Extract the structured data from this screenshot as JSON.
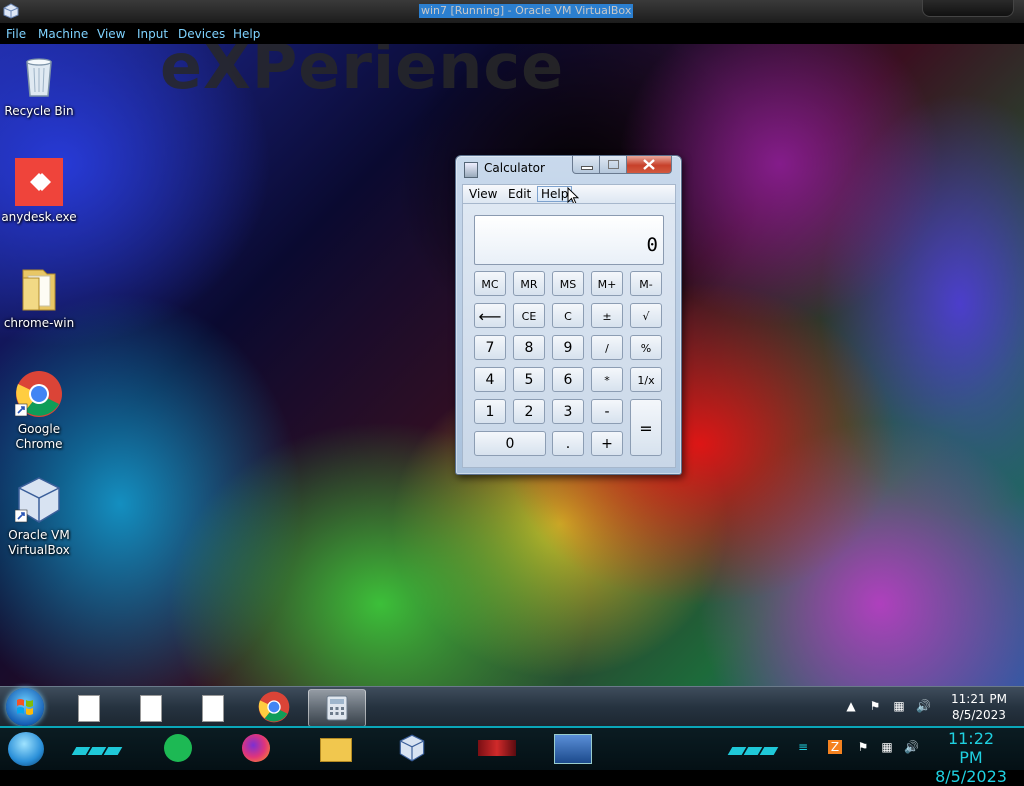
{
  "host_window": {
    "title": "win7 [Running] - Oracle VM VirtualBox",
    "menu": [
      "File",
      "Machine",
      "View",
      "Input",
      "Devices",
      "Help"
    ]
  },
  "desktop": {
    "watermark": "eXPerience",
    "icons": [
      {
        "label": "Recycle Bin",
        "icon": "recycle-bin-icon"
      },
      {
        "label": "anydesk.exe",
        "icon": "anydesk-icon",
        "color": "#ef443b"
      },
      {
        "label": "chrome-win",
        "icon": "folder-icon"
      },
      {
        "label": "Google Chrome",
        "icon": "chrome-icon"
      },
      {
        "label": "Oracle VM VirtualBox",
        "icon": "virtualbox-icon"
      }
    ]
  },
  "calculator": {
    "title": "Calculator",
    "menu": [
      "View",
      "Edit",
      "Help"
    ],
    "display": "0",
    "keys": {
      "mc": "MC",
      "mr": "MR",
      "ms": "MS",
      "mplus": "M+",
      "mminus": "M-",
      "backspace": "⟵",
      "ce": "CE",
      "c": "C",
      "plusminus": "±",
      "sqrt": "√",
      "k7": "7",
      "k8": "8",
      "k9": "9",
      "divide": "/",
      "percent": "%",
      "k4": "4",
      "k5": "5",
      "k6": "6",
      "multiply": "*",
      "reciprocal": "1/x",
      "k1": "1",
      "k2": "2",
      "k3": "3",
      "minus": "-",
      "equals": "=",
      "k0": "0",
      "decimal": ".",
      "plus": "+"
    }
  },
  "guest_taskbar": {
    "clock_time": "11:21 PM",
    "clock_date": "8/5/2023"
  },
  "host_taskbar": {
    "clock_time": "11:22 PM",
    "clock_date": "8/5/2023",
    "accent": "#1fc8d8"
  }
}
